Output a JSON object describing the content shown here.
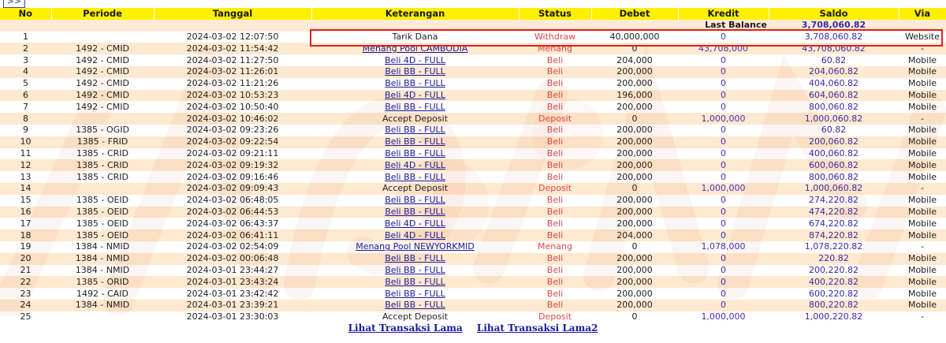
{
  "nav": {
    "next_label": ">>"
  },
  "headers": [
    "No",
    "Periode",
    "Tanggal",
    "Keterangan",
    "Status",
    "Debet",
    "Kredit",
    "Saldo",
    "Via"
  ],
  "last_balance": {
    "label": "Last Balance",
    "value": "3,708,060.82"
  },
  "rows": [
    {
      "no": "1",
      "periode": "",
      "tanggal": "2024-03-02 12:07:50",
      "keterangan": "Tarik Dana",
      "link": false,
      "status": "Withdraw",
      "debet": "40,000,000",
      "kredit": "0",
      "saldo": "3,708,060.82",
      "via": "Website"
    },
    {
      "no": "2",
      "periode": "1492 - CMID",
      "tanggal": "2024-03-02 11:54:42",
      "keterangan": "Menang Pool CAMBODIA",
      "link": true,
      "status": "Menang",
      "debet": "0",
      "kredit": "43,708,000",
      "saldo": "43,708,060.82",
      "via": "-"
    },
    {
      "no": "3",
      "periode": "1492 - CMID",
      "tanggal": "2024-03-02 11:27:50",
      "keterangan": "Beli 4D - FULL",
      "link": true,
      "status": "Beli",
      "debet": "204,000",
      "kredit": "0",
      "saldo": "60.82",
      "via": "Mobile"
    },
    {
      "no": "4",
      "periode": "1492 - CMID",
      "tanggal": "2024-03-02 11:26:01",
      "keterangan": "Beli BB - FULL",
      "link": true,
      "status": "Beli",
      "debet": "200,000",
      "kredit": "0",
      "saldo": "204,060.82",
      "via": "Mobile"
    },
    {
      "no": "5",
      "periode": "1492 - CMID",
      "tanggal": "2024-03-02 11:21:26",
      "keterangan": "Beli BB - FULL",
      "link": true,
      "status": "Beli",
      "debet": "200,000",
      "kredit": "0",
      "saldo": "404,060.82",
      "via": "Mobile"
    },
    {
      "no": "6",
      "periode": "1492 - CMID",
      "tanggal": "2024-03-02 10:53:23",
      "keterangan": "Beli 4D - FULL",
      "link": true,
      "status": "Beli",
      "debet": "196,000",
      "kredit": "0",
      "saldo": "604,060.82",
      "via": "Mobile"
    },
    {
      "no": "7",
      "periode": "1492 - CMID",
      "tanggal": "2024-03-02 10:50:40",
      "keterangan": "Beli BB - FULL",
      "link": true,
      "status": "Beli",
      "debet": "200,000",
      "kredit": "0",
      "saldo": "800,060.82",
      "via": "Mobile"
    },
    {
      "no": "8",
      "periode": "",
      "tanggal": "2024-03-02 10:46:02",
      "keterangan": "Accept Deposit",
      "link": false,
      "status": "Deposit",
      "debet": "0",
      "kredit": "1,000,000",
      "saldo": "1,000,060.82",
      "via": "-"
    },
    {
      "no": "9",
      "periode": "1385 - OGID",
      "tanggal": "2024-03-02 09:23:26",
      "keterangan": "Beli BB - FULL",
      "link": true,
      "status": "Beli",
      "debet": "200,000",
      "kredit": "0",
      "saldo": "60.82",
      "via": "Mobile"
    },
    {
      "no": "10",
      "periode": "1385 - FRID",
      "tanggal": "2024-03-02 09:22:54",
      "keterangan": "Beli BB - FULL",
      "link": true,
      "status": "Beli",
      "debet": "200,000",
      "kredit": "0",
      "saldo": "200,060.82",
      "via": "Mobile"
    },
    {
      "no": "11",
      "periode": "1385 - CRID",
      "tanggal": "2024-03-02 09:21:11",
      "keterangan": "Beli BB - FULL",
      "link": true,
      "status": "Beli",
      "debet": "200,000",
      "kredit": "0",
      "saldo": "400,060.82",
      "via": "Mobile"
    },
    {
      "no": "12",
      "periode": "1385 - CRID",
      "tanggal": "2024-03-02 09:19:32",
      "keterangan": "Beli 4D - FULL",
      "link": true,
      "status": "Beli",
      "debet": "200,000",
      "kredit": "0",
      "saldo": "600,060.82",
      "via": "Mobile"
    },
    {
      "no": "13",
      "periode": "1385 - CRID",
      "tanggal": "2024-03-02 09:16:46",
      "keterangan": "Beli BB - FULL",
      "link": true,
      "status": "Beli",
      "debet": "200,000",
      "kredit": "0",
      "saldo": "800,060.82",
      "via": "Mobile"
    },
    {
      "no": "14",
      "periode": "",
      "tanggal": "2024-03-02 09:09:43",
      "keterangan": "Accept Deposit",
      "link": false,
      "status": "Deposit",
      "debet": "0",
      "kredit": "1,000,000",
      "saldo": "1,000,060.82",
      "via": "-"
    },
    {
      "no": "15",
      "periode": "1385 - OEID",
      "tanggal": "2024-03-02 06:48:05",
      "keterangan": "Beli BB - FULL",
      "link": true,
      "status": "Beli",
      "debet": "200,000",
      "kredit": "0",
      "saldo": "274,220.82",
      "via": "Mobile"
    },
    {
      "no": "16",
      "periode": "1385 - OEID",
      "tanggal": "2024-03-02 06:44:53",
      "keterangan": "Beli BB - FULL",
      "link": true,
      "status": "Beli",
      "debet": "200,000",
      "kredit": "0",
      "saldo": "474,220.82",
      "via": "Mobile"
    },
    {
      "no": "17",
      "periode": "1385 - OEID",
      "tanggal": "2024-03-02 06:43:37",
      "keterangan": "Beli 4D - FULL",
      "link": true,
      "status": "Beli",
      "debet": "200,000",
      "kredit": "0",
      "saldo": "674,220.82",
      "via": "Mobile"
    },
    {
      "no": "18",
      "periode": "1385 - OEID",
      "tanggal": "2024-03-02 06:41:11",
      "keterangan": "Beli 4D - FULL",
      "link": true,
      "status": "Beli",
      "debet": "204,000",
      "kredit": "0",
      "saldo": "874,220.82",
      "via": "Mobile"
    },
    {
      "no": "19",
      "periode": "1384 - NMID",
      "tanggal": "2024-03-02 02:54:09",
      "keterangan": "Menang Pool NEWYORKMID",
      "link": true,
      "status": "Menang",
      "debet": "0",
      "kredit": "1,078,000",
      "saldo": "1,078,220.82",
      "via": "-"
    },
    {
      "no": "20",
      "periode": "1384 - NMID",
      "tanggal": "2024-03-02 00:06:48",
      "keterangan": "Beli BB - FULL",
      "link": true,
      "status": "Beli",
      "debet": "200,000",
      "kredit": "0",
      "saldo": "220.82",
      "via": "Mobile"
    },
    {
      "no": "21",
      "periode": "1384 - NMID",
      "tanggal": "2024-03-01 23:44:27",
      "keterangan": "Beli BB - FULL",
      "link": true,
      "status": "Beli",
      "debet": "200,000",
      "kredit": "0",
      "saldo": "200,220.82",
      "via": "Mobile"
    },
    {
      "no": "22",
      "periode": "1385 - ORID",
      "tanggal": "2024-03-01 23:43:24",
      "keterangan": "Beli BB - FULL",
      "link": true,
      "status": "Beli",
      "debet": "200,000",
      "kredit": "0",
      "saldo": "400,220.82",
      "via": "Mobile"
    },
    {
      "no": "23",
      "periode": "1492 - CAID",
      "tanggal": "2024-03-01 23:42:42",
      "keterangan": "Beli BB - FULL",
      "link": true,
      "status": "Beli",
      "debet": "200,000",
      "kredit": "0",
      "saldo": "600,220.82",
      "via": "Mobile"
    },
    {
      "no": "24",
      "periode": "1384 - NMID",
      "tanggal": "2024-03-01 23:39:21",
      "keterangan": "Beli BB - FULL",
      "link": true,
      "status": "Beli",
      "debet": "200,000",
      "kredit": "0",
      "saldo": "800,220.82",
      "via": "Mobile"
    },
    {
      "no": "25",
      "periode": "",
      "tanggal": "2024-03-01 23:30:03",
      "keterangan": "Accept Deposit",
      "link": false,
      "status": "Deposit",
      "debet": "0",
      "kredit": "1,000,000",
      "saldo": "1,000,220.82",
      "via": "-"
    }
  ],
  "footer": {
    "link1": "Lihat Transaksi Lama",
    "link2": "Lihat Transaksi Lama2"
  },
  "colors": {
    "header_bg": "#fff000",
    "status_red": "#e04848",
    "link_blue": "#1a1a9c",
    "saldo_purple": "#3a2aa8",
    "highlight": "#e02020"
  }
}
